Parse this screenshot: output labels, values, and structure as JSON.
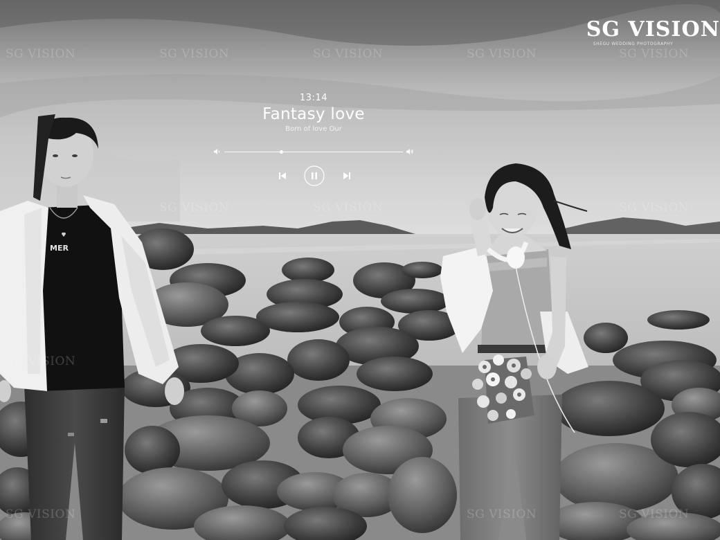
{
  "brand": {
    "title": "SG VISION",
    "subtitle": "SHEGU WEDDING PHOTOGRAPHY"
  },
  "watermark_text": "SG VISION",
  "player": {
    "time": "13:14",
    "song_title": "Fantasy love",
    "artist": "Born of love Our",
    "progress": 0.32,
    "controls": [
      "previous",
      "pause",
      "next"
    ]
  },
  "shirt_print": "MER"
}
